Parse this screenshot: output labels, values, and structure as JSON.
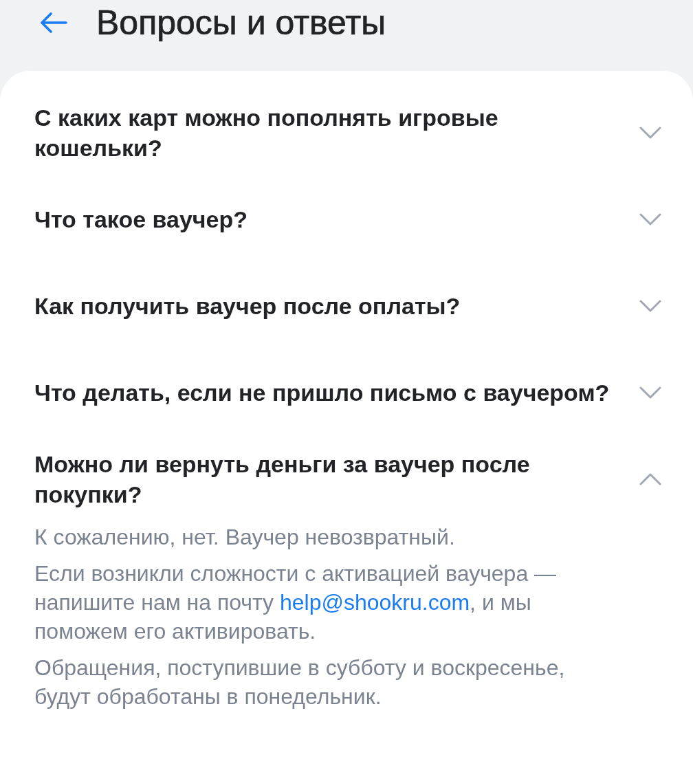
{
  "header": {
    "title": "Вопросы и ответы"
  },
  "faq": [
    {
      "question": "С каких карт можно пополнять игровые кошельки?",
      "expanded": false
    },
    {
      "question": "Что такое ваучер?",
      "expanded": false
    },
    {
      "question": "Как получить ваучер после оплаты?",
      "expanded": false
    },
    {
      "question": "Что делать, если не пришло письмо с ваучером?",
      "expanded": false
    },
    {
      "question": "Можно ли вернуть деньги за ваучер после покупки?",
      "expanded": true,
      "answer": [
        {
          "parts": [
            {
              "kind": "text",
              "text": "К сожалению, нет. Ваучер невозвратный."
            }
          ]
        },
        {
          "parts": [
            {
              "kind": "text",
              "text": "Если возникли сложности с активацией ваучера — напишите нам на почту "
            },
            {
              "kind": "link",
              "text": "help@shookru.com"
            },
            {
              "kind": "text",
              "text": ", и мы поможем его активировать."
            }
          ]
        },
        {
          "parts": [
            {
              "kind": "text",
              "text": "Обращения, поступившие в субботу и воскресенье, будут обработаны в понедельник."
            }
          ]
        }
      ]
    }
  ]
}
